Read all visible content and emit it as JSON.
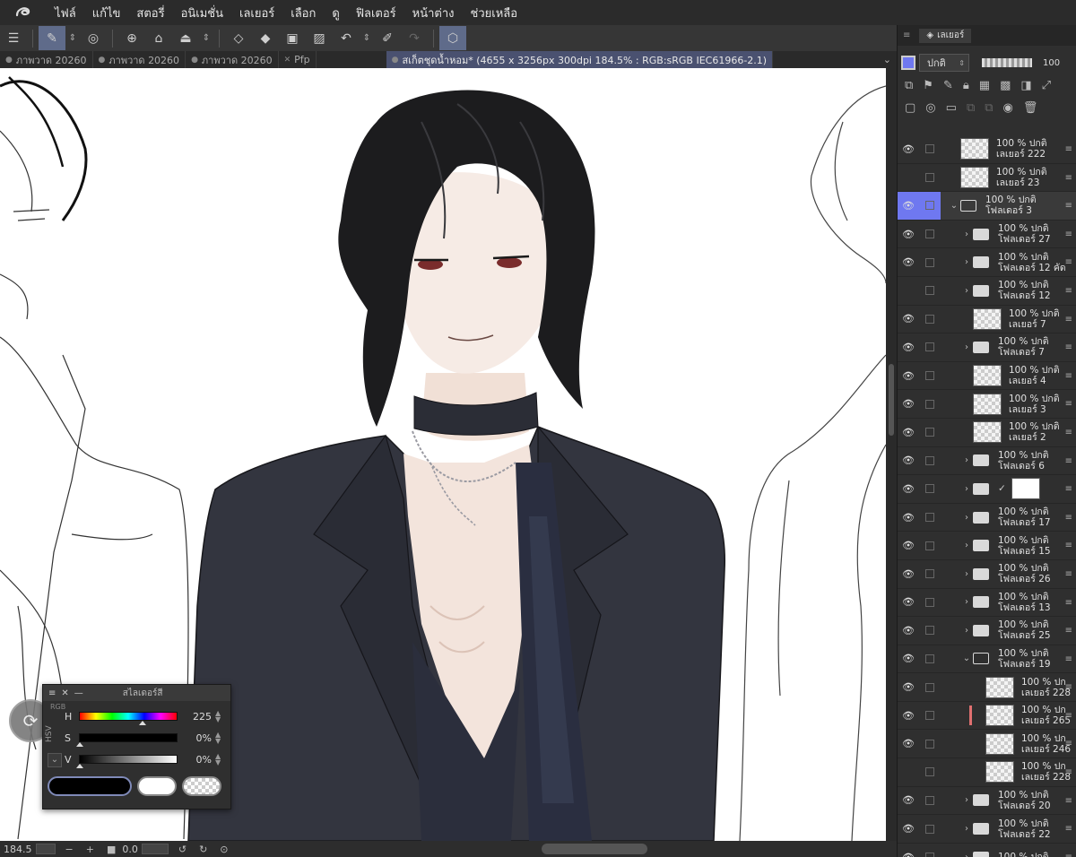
{
  "menubar": {
    "items": [
      "ไฟล์",
      "แก้ไข",
      "สตอรี่",
      "อนิเมชั่น",
      "เลเยอร์",
      "เลือก",
      "ดู",
      "ฟิลเตอร์",
      "หน้าต่าง",
      "ช่วยเหลือ"
    ]
  },
  "tabs": [
    {
      "label": "ภาพวาด 20260",
      "dot": "●"
    },
    {
      "label": "ภาพวาด 20260",
      "dot": "●"
    },
    {
      "label": "ภาพวาด 20260",
      "dot": "●"
    },
    {
      "label": "Pfp",
      "dot": "✕"
    }
  ],
  "active_tab": {
    "label": "สเก็ตชุดน้ำหอม* (4655 x 3256px 300dpi 184.5% : RGB:sRGB IEC61966-2.1)",
    "dot": "●"
  },
  "statusbar": {
    "zoom": "184.5",
    "angle": "0.0"
  },
  "color_panel": {
    "title": "สไลเดอร์สี",
    "side_label": "HSV",
    "rgb_label": "RGB",
    "sliders": [
      {
        "label": "H",
        "value": "225",
        "marker_fraction": 0.62
      },
      {
        "label": "S",
        "value": "0%",
        "marker_fraction": 0.0
      },
      {
        "label": "V",
        "value": "0%",
        "marker_fraction": 0.0
      }
    ]
  },
  "layer_panel": {
    "tab_label": "เลเยอร์",
    "blend_mode": "ปกติ",
    "opacity": "100",
    "layers": [
      {
        "kind": "layer",
        "visible": true,
        "indent": 0,
        "line1": "100 % ปกติ",
        "line2": "เลเยอร์ 222"
      },
      {
        "kind": "layer",
        "visible": false,
        "indent": 0,
        "line1": "100 % ปกติ",
        "line2": "เลเยอร์ 23"
      },
      {
        "kind": "folder-open",
        "visible": true,
        "indent": 0,
        "selected": true,
        "line1": "100 % ปกติ",
        "line2": "โฟลเดอร์ 3"
      },
      {
        "kind": "folder",
        "visible": true,
        "indent": 1,
        "line1": "100 % ปกติ",
        "line2": "โฟลเดอร์ 27"
      },
      {
        "kind": "folder",
        "visible": true,
        "indent": 1,
        "line1": "100 % ปกติ",
        "line2": "โฟลเดอร์ 12 คัด"
      },
      {
        "kind": "folder",
        "visible": false,
        "indent": 1,
        "line1": "100 % ปกติ",
        "line2": "โฟลเดอร์ 12"
      },
      {
        "kind": "layer",
        "visible": true,
        "indent": 1,
        "line1": "100 % ปกติ",
        "line2": "เลเยอร์ 7"
      },
      {
        "kind": "folder",
        "visible": true,
        "indent": 1,
        "line1": "100 % ปกติ",
        "line2": "โฟลเดอร์ 7"
      },
      {
        "kind": "layer",
        "visible": true,
        "indent": 1,
        "line1": "100 % ปกติ",
        "line2": "เลเยอร์ 4"
      },
      {
        "kind": "layer",
        "visible": true,
        "indent": 1,
        "line1": "100 % ปกติ",
        "line2": "เลเยอร์ 3"
      },
      {
        "kind": "layer",
        "visible": true,
        "indent": 1,
        "line1": "100 % ปกติ",
        "line2": "เลเยอร์ 2"
      },
      {
        "kind": "folder",
        "visible": true,
        "indent": 1,
        "line1": "100 % ปกติ",
        "line2": "โฟลเดอร์ 6"
      },
      {
        "kind": "paper",
        "visible": true,
        "indent": 1,
        "line1": "",
        "line2": ""
      },
      {
        "kind": "folder",
        "visible": true,
        "indent": 1,
        "line1": "100 % ปกติ",
        "line2": "โฟลเดอร์ 17"
      },
      {
        "kind": "folder",
        "visible": true,
        "indent": 1,
        "line1": "100 % ปกติ",
        "line2": "โฟลเดอร์ 15"
      },
      {
        "kind": "folder",
        "visible": true,
        "indent": 1,
        "line1": "100 % ปกติ",
        "line2": "โฟลเดอร์ 26"
      },
      {
        "kind": "folder",
        "visible": true,
        "indent": 1,
        "line1": "100 % ปกติ",
        "line2": "โฟลเดอร์ 13"
      },
      {
        "kind": "folder",
        "visible": true,
        "indent": 1,
        "line1": "100 % ปกติ",
        "line2": "โฟลเดอร์ 25"
      },
      {
        "kind": "folder-open",
        "visible": true,
        "indent": 1,
        "line1": "100 % ปกติ",
        "line2": "โฟลเดอร์ 19"
      },
      {
        "kind": "layer",
        "visible": true,
        "indent": 2,
        "line1": "100 % ปก",
        "line2": "เลเยอร์ 228"
      },
      {
        "kind": "layer",
        "visible": true,
        "indent": 2,
        "marker": true,
        "line1": "100 % ปก",
        "line2": "เลเยอร์ 265"
      },
      {
        "kind": "layer",
        "visible": true,
        "indent": 2,
        "line1": "100 % ปก",
        "line2": "เลเยอร์ 246"
      },
      {
        "kind": "layer",
        "visible": false,
        "indent": 2,
        "line1": "100 % ปก",
        "line2": "เลเยอร์ 228"
      },
      {
        "kind": "folder",
        "visible": true,
        "indent": 1,
        "line1": "100 % ปกติ",
        "line2": "โฟลเดอร์ 20"
      },
      {
        "kind": "folder",
        "visible": true,
        "indent": 1,
        "line1": "100 % ปกติ",
        "line2": "โฟลเดอร์ 22"
      },
      {
        "kind": "folder",
        "visible": true,
        "indent": 1,
        "line1": "100 % ปกติ",
        "line2": ""
      }
    ]
  },
  "colors": {
    "accent": "#6f78f0",
    "jacket": "#33353f",
    "choker": "#2b2d36",
    "skin": "#f3e4dc",
    "hair": "#1c1c1e"
  }
}
